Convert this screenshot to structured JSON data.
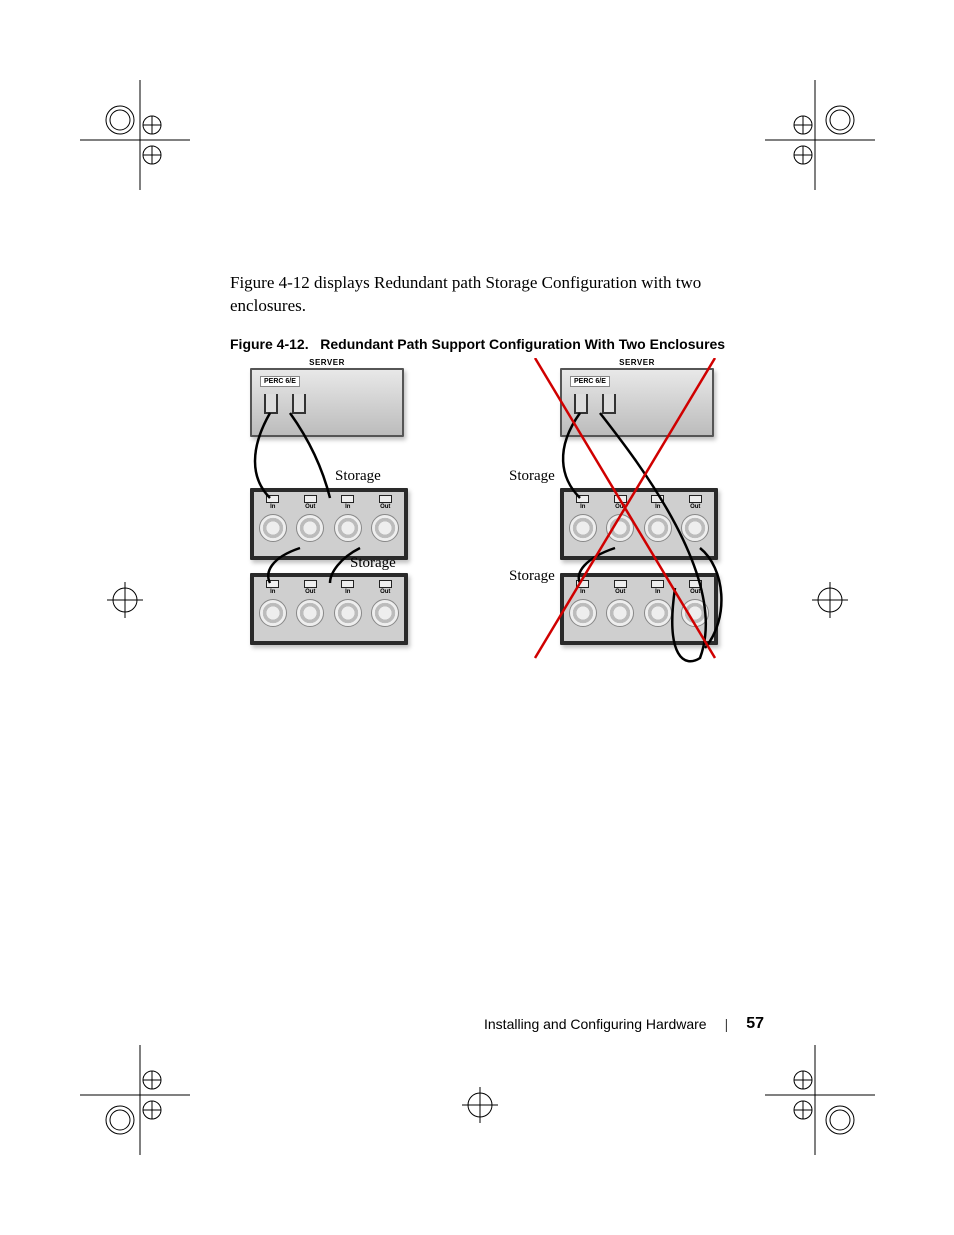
{
  "body_text": "Figure 4-12 displays Redundant path Storage Configuration with two enclosures.",
  "figure": {
    "number": "Figure 4-12.",
    "title": "Redundant Path Support Configuration With Two Enclosures"
  },
  "labels": {
    "server": "SERVER",
    "perc": "PERC 6/E",
    "storage": "Storage",
    "in": "In",
    "out": "Out"
  },
  "footer": {
    "section": "Installing and Configuring Hardware",
    "page": "57"
  }
}
